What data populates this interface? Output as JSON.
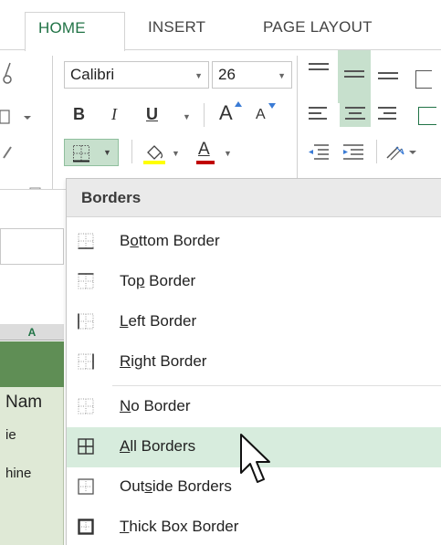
{
  "ribbon": {
    "tabs": [
      {
        "label": "HOME",
        "active": true
      },
      {
        "label": "INSERT",
        "active": false
      },
      {
        "label": "PAGE LAYOUT",
        "active": false
      }
    ],
    "font_name": "Calibri",
    "font_size": "26",
    "bold_label": "B",
    "italic_label": "I",
    "underline_label": "U",
    "grow_font_label": "A",
    "shrink_font_label": "A",
    "font_color_label": "A"
  },
  "sheet": {
    "column_header": "A",
    "cells": [
      "Nam",
      "ie",
      "hine"
    ]
  },
  "borders_menu": {
    "header": "Borders",
    "items": [
      {
        "pre": "B",
        "key": "o",
        "post": "ttom Border",
        "icon": "bottom-border-icon"
      },
      {
        "pre": "To",
        "key": "p",
        "post": " Border",
        "icon": "top-border-icon"
      },
      {
        "pre": "",
        "key": "L",
        "post": "eft Border",
        "icon": "left-border-icon"
      },
      {
        "pre": "",
        "key": "R",
        "post": "ight Border",
        "icon": "right-border-icon"
      },
      {
        "pre": "",
        "key": "N",
        "post": "o Border",
        "icon": "no-border-icon"
      },
      {
        "pre": "",
        "key": "A",
        "post": "ll Borders",
        "icon": "all-borders-icon"
      },
      {
        "pre": "Out",
        "key": "s",
        "post": "ide Borders",
        "icon": "outside-borders-icon"
      },
      {
        "pre": "",
        "key": "T",
        "post": "hick Box Border",
        "icon": "thick-box-border-icon"
      }
    ],
    "hovered": "All Borders"
  },
  "colors": {
    "accent": "#217346",
    "hover_bg": "#d7ecdd",
    "header_bg": "#eaeaea",
    "border_button_bg": "#c7e0cd",
    "font_color_bar": "#c00000",
    "fill_color_bar": "#ffff00"
  }
}
